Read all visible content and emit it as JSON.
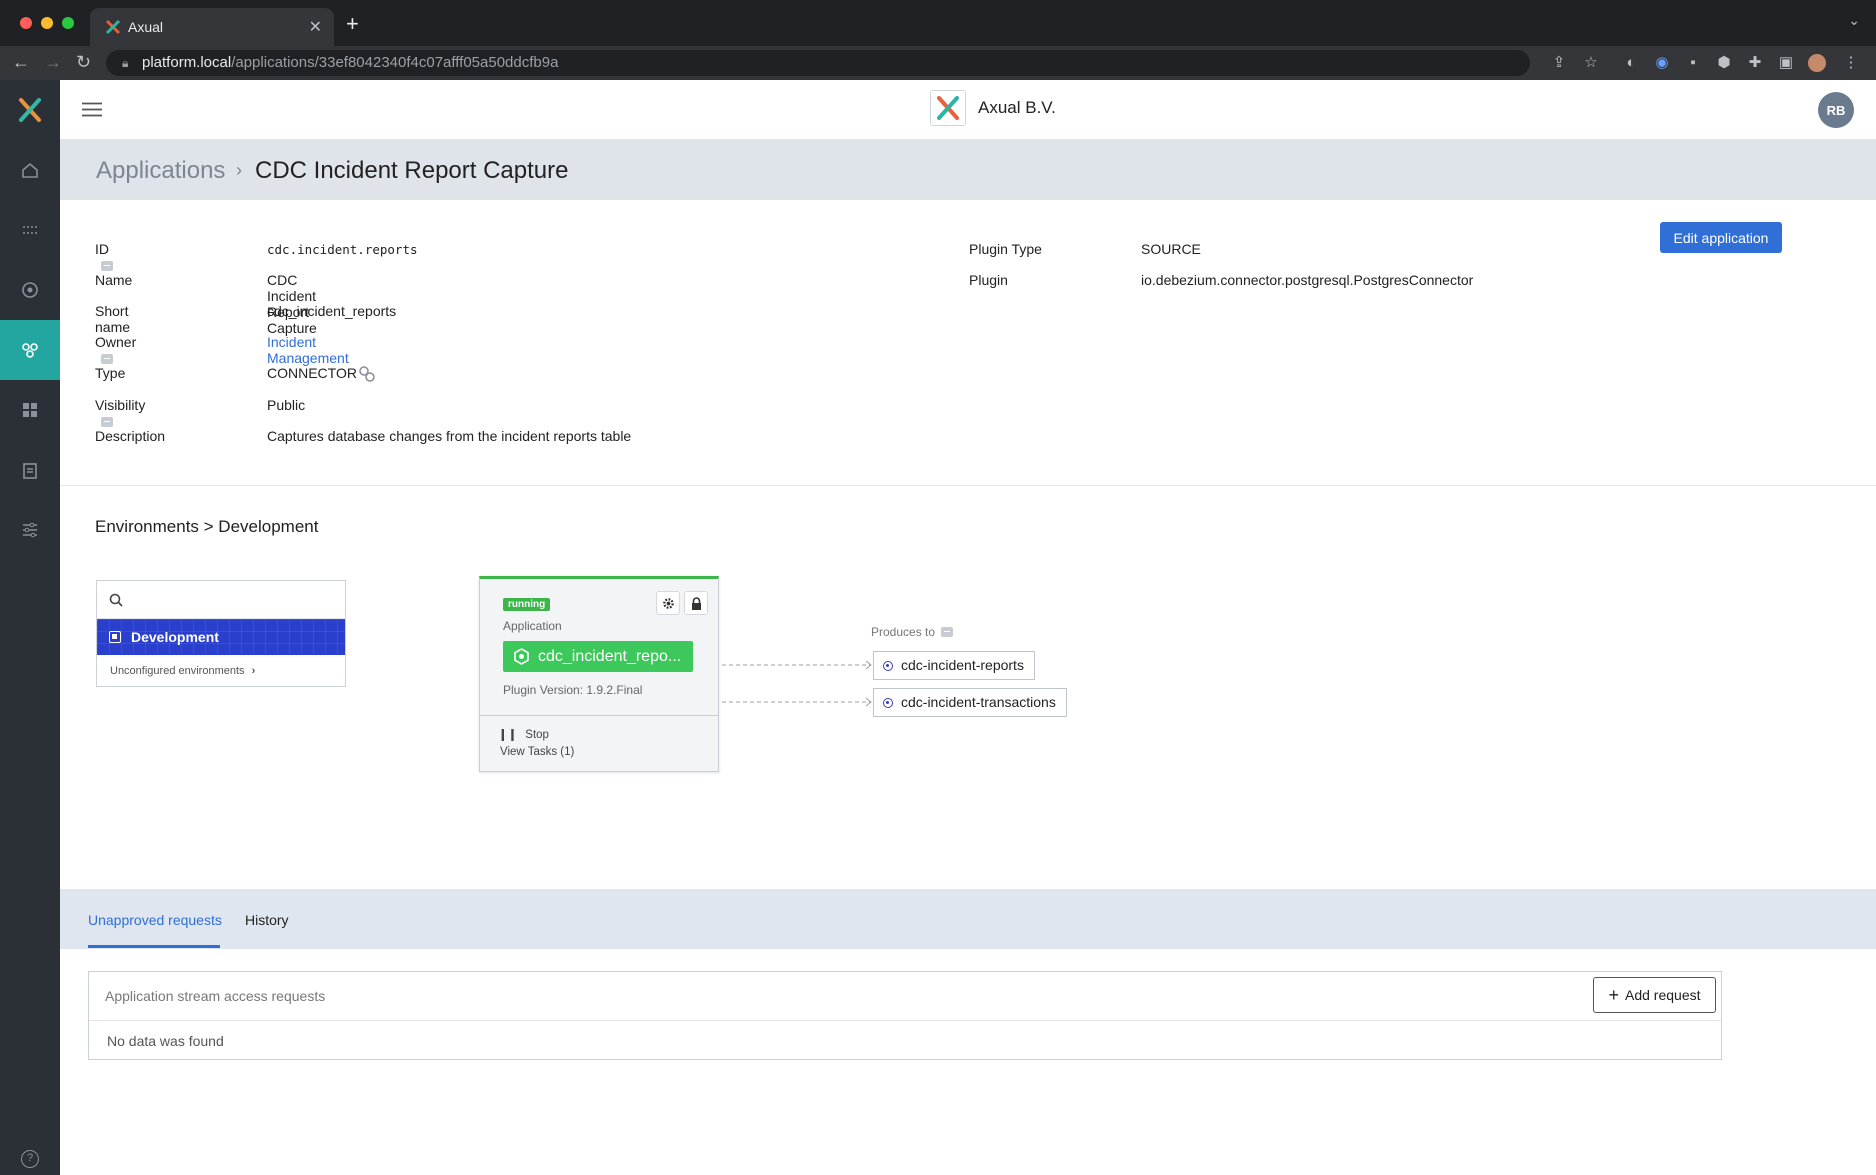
{
  "browser": {
    "tab_title": "Axual",
    "url_host": "platform.local",
    "url_path": "/applications/33ef8042340f4c07afff05a50ddcfb9a"
  },
  "colors": {
    "accent": "#2f6fd6",
    "sidebar_active": "#23a6a0",
    "running": "#3cb54a",
    "env_selected": "#2a3fcc"
  },
  "topbar": {
    "org_name": "Axual B.V.",
    "avatar_initials": "RB"
  },
  "breadcrumb": {
    "parent": "Applications",
    "separator": "›",
    "current": "CDC Incident Report Capture"
  },
  "details": {
    "edit_label": "Edit application",
    "fields": {
      "id": {
        "label": "ID",
        "value": "cdc.incident.reports"
      },
      "name": {
        "label": "Name",
        "value": "CDC Incident Report Capture"
      },
      "short_name": {
        "label": "Short name",
        "value": "cdc_incident_reports"
      },
      "owner": {
        "label": "Owner",
        "value": "Incident Management"
      },
      "type": {
        "label": "Type",
        "value": "CONNECTOR"
      },
      "visibility": {
        "label": "Visibility",
        "value": "Public"
      },
      "description": {
        "label": "Description",
        "value": "Captures database changes from the incident reports table"
      },
      "plugin_type": {
        "label": "Plugin Type",
        "value": "SOURCE"
      },
      "plugin": {
        "label": "Plugin",
        "value": "io.debezium.connector.postgresql.PostgresConnector"
      }
    }
  },
  "environments": {
    "title": "Environments > Development",
    "search_placeholder": "",
    "selected": "Development",
    "unconfigured": "Unconfigured environments"
  },
  "app_card": {
    "status": "running",
    "label": "Application",
    "name": "cdc_incident_repo...",
    "plugin_version": "Plugin Version: 1.9.2.Final",
    "stop": "Stop",
    "view_tasks": "View Tasks (1)"
  },
  "produces": {
    "label": "Produces to",
    "topics": [
      "cdc-incident-reports",
      "cdc-incident-transactions"
    ]
  },
  "requests": {
    "tabs": [
      "Unapproved requests",
      "History"
    ],
    "title": "Application stream access requests",
    "add_label": "Add request",
    "empty": "No data was found"
  }
}
